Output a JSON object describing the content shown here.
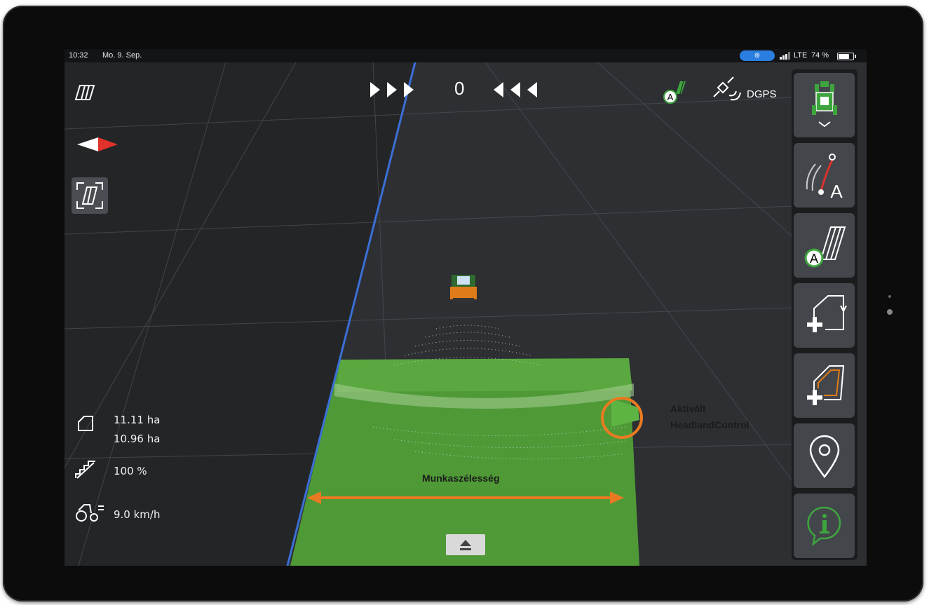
{
  "status_bar": {
    "time": "10:32",
    "date": "Mo. 9. Sep.",
    "network": "LTE",
    "battery": "74 %",
    "battery_level": 0.74
  },
  "guidance": {
    "offset_value": "0",
    "gps_mode": "DGPS"
  },
  "stats": {
    "area_total": "11.11 ha",
    "area_worked": "10.96 ha",
    "application_rate": "100 %",
    "speed": "9.0 km/h"
  },
  "annotations": {
    "working_width": "Munkaszélesség",
    "headland_line1": "Aktivált",
    "headland_line2": "HeadlandControl"
  },
  "sidebar": {
    "items": [
      {
        "name": "tractor-implement-icon",
        "accent": "#3ea53e"
      },
      {
        "name": "guidance-line-a-icon",
        "accent": "#d9322e"
      },
      {
        "name": "auto-section-icon",
        "accent": "#3ea53e"
      },
      {
        "name": "add-field-boundary-icon",
        "accent": "#ffffff"
      },
      {
        "name": "add-headland-icon",
        "accent": "#e07b1a"
      },
      {
        "name": "location-pin-icon",
        "accent": "#ffffff"
      },
      {
        "name": "info-icon",
        "accent": "#3ea53e"
      }
    ]
  },
  "colors": {
    "field_green": "#4f9a37",
    "boundary_blue": "#3b6fd6",
    "annotation_orange": "#ea7a22",
    "panel": "#43464b"
  }
}
